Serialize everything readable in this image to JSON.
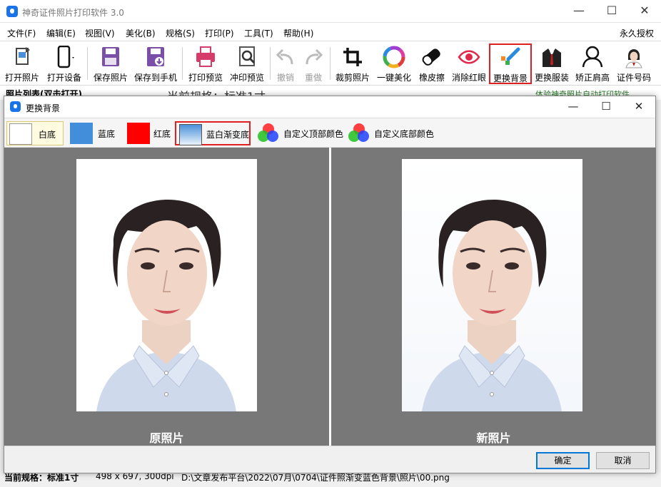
{
  "app": {
    "title": "神奇证件照片打印软件 3.0",
    "license": "永久授权"
  },
  "menu": [
    "文件(F)",
    "编辑(E)",
    "视图(V)",
    "美化(B)",
    "规格(S)",
    "打印(P)",
    "工具(T)",
    "帮助(H)"
  ],
  "toolbar": {
    "open_photo": "打开照片",
    "open_device": "打开设备",
    "save_photo": "保存照片",
    "save_to_phone": "保存到手机",
    "print_preview": "打印预览",
    "develop_preview": "冲印预览",
    "undo": "撤销",
    "redo": "重做",
    "crop": "裁剪照片",
    "beautify": "一键美化",
    "eraser": "橡皮擦",
    "red_eye": "消除红眼",
    "change_bg": "更换背景",
    "change_clothes": "更换服装",
    "fix_shoulder": "矫正肩高",
    "id_number": "证件号码"
  },
  "under": {
    "photo_list": "照片列表(双击打开)",
    "current_spec": "当前规格：标准1寸",
    "tip": "体验神奇照片自动打印软件"
  },
  "status": {
    "spec": "当前规格：标准1寸",
    "size": "498 x 697, 300dpi",
    "path": "D:\\文章发布平台\\2022\\07月\\0704\\证件照渐变蓝色背景\\照片\\00.png"
  },
  "dialog": {
    "title": "更换背景",
    "options": [
      {
        "label": "白底",
        "color": "#ffffff"
      },
      {
        "label": "蓝底",
        "color": "#438edb"
      },
      {
        "label": "红底",
        "color": "#ff0000"
      },
      {
        "label": "蓝白渐变底",
        "color": "#6aa9dc"
      }
    ],
    "custom_top": "自定义顶部颜色",
    "custom_bottom": "自定义底部颜色",
    "original_caption": "原照片",
    "new_caption": "新照片",
    "ok": "确定",
    "cancel": "取消"
  },
  "colors": {
    "accent": "#1a73e8",
    "highlight_border": "#e02020",
    "preview_bg": "#787878"
  }
}
